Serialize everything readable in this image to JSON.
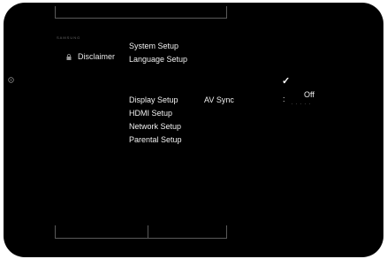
{
  "header": {
    "brand": "SAMSUNG"
  },
  "sidebar": {
    "disclaimer_label": "Disclaimer",
    "disclaimer_icon": "lock-icon"
  },
  "setup_menu": {
    "items_top": [
      "System Setup",
      "Language Setup"
    ],
    "items_bottom": [
      "Display Setup",
      "HDMI Setup",
      "Network Setup",
      "Parental Setup"
    ]
  },
  "setting": {
    "label": "AV Sync",
    "separator": ":",
    "value": "Off",
    "selected_mark": "✓",
    "dots": "....."
  },
  "colors": {
    "background": "#000000",
    "text": "#f0f0f0",
    "frame": "#5a5a5a"
  }
}
